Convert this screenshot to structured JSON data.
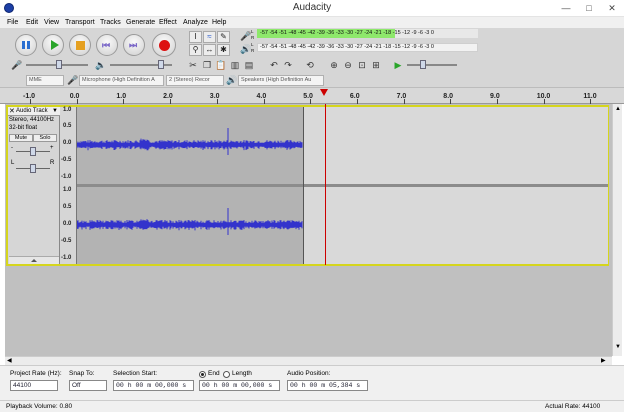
{
  "window": {
    "title": "Audacity",
    "minimize": "—",
    "maximize": "□",
    "close": "✕"
  },
  "menu": [
    "File",
    "Edit",
    "View",
    "Transport",
    "Tracks",
    "Generate",
    "Effect",
    "Analyze",
    "Help"
  ],
  "meters": {
    "record_scale": "-57 -54 -51 -48 -45 -42 -39 -36 -33 -30 -27 -24 -21 -18 -15 -12 -9 -6 -3 0",
    "play_scale": "-57 -54 -51 -48 -45 -42 -39 -36 -33 -30 -27 -24 -21 -18 -15 -12 -9 -6 -3 0",
    "record_channel_top": "L",
    "record_channel_bottom": "R",
    "play_channel_top": "L",
    "play_channel_bottom": "R"
  },
  "devices": {
    "host": "MME",
    "input": "Microphone (High Definition A",
    "channels": "2 (Stereo) Recor",
    "output": "Speakers (High Definition Au"
  },
  "ruler": {
    "ticks": [
      "-1.0",
      "0.0",
      "1.0",
      "2.0",
      "3.0",
      "4.0",
      "5.0",
      "6.0",
      "7.0",
      "8.0",
      "9.0",
      "10.0",
      "11.0"
    ]
  },
  "track": {
    "name": "Audio Track",
    "info1": "Stereo, 44100Hz",
    "info2": "32-bit float",
    "mute": "Mute",
    "solo": "Solo",
    "gain_minus": "-",
    "gain_plus": "+",
    "pan_left": "L",
    "pan_right": "R",
    "scale_top": "1.0",
    "scale_upper": "0.5",
    "scale_mid": "0.0",
    "scale_lower": "-0.5",
    "scale_bottom": "-1.0"
  },
  "selection_toolbar": {
    "project_rate_label": "Project Rate (Hz):",
    "project_rate_value": "44100",
    "snap_to_label": "Snap To:",
    "snap_to_value": "Off",
    "selection_start_label": "Selection Start:",
    "selection_start_value": "00 h 00 m 00,000 s",
    "end_label": "End",
    "length_label": "Length",
    "end_value": "00 h 00 m 00,000 s",
    "audio_position_label": "Audio Position:",
    "audio_position_value": "00 h 00 m 05,384 s"
  },
  "status": {
    "left": "Playback Volume: 0.80",
    "right": "Actual Rate: 44100"
  },
  "colors": {
    "waveform": "#3333cc",
    "selection": "#b3b3b3",
    "track_border": "#d5d51d",
    "cursor": "#cc0000",
    "meter_green": "#8ee86b"
  }
}
